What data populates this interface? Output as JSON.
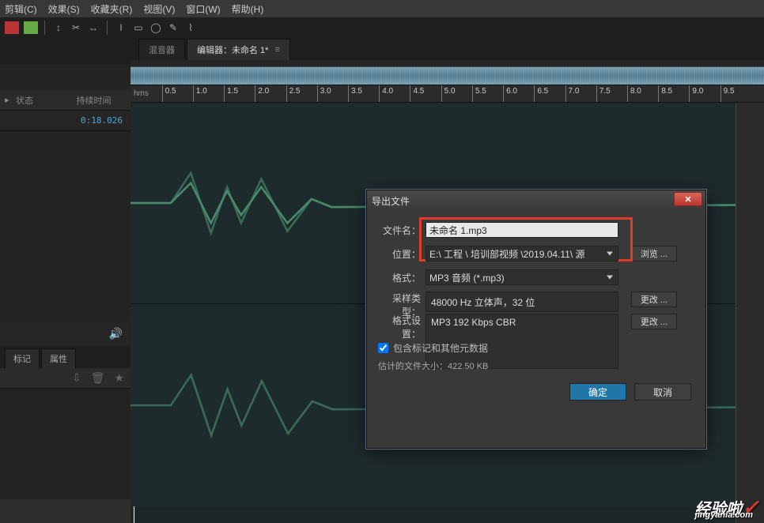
{
  "menu": {
    "items": [
      "剪辑(C)",
      "效果(S)",
      "收藏夹(R)",
      "视图(V)",
      "窗口(W)",
      "帮助(H)"
    ]
  },
  "side": {
    "col_state": "状态",
    "col_duration": "持续时间",
    "duration_value": "0:18.026",
    "tab_marker": "标记",
    "tab_props": "属性"
  },
  "tabs": {
    "mixer": "混音器",
    "editor": "编辑器：未命名 1*"
  },
  "ruler": {
    "unit": "hms",
    "ticks": [
      "0.5",
      "1.0",
      "1.5",
      "2.0",
      "2.5",
      "3.0",
      "3.5",
      "4.0",
      "4.5",
      "5.0",
      "5.5",
      "6.0",
      "6.5",
      "7.0",
      "7.5",
      "8.0",
      "8.5",
      "9.0",
      "9.5"
    ]
  },
  "dialog": {
    "title": "导出文件",
    "labels": {
      "filename": "文件名：",
      "location": "位置：",
      "format": "格式：",
      "sample": "采样类型：",
      "fmt_setting": "格式设置："
    },
    "values": {
      "filename": "未命名 1.mp3",
      "location": "E:\\ 工程 \\ 培训部视频 \\2019.04.11\\ 源",
      "format": "MP3 音频 (*.mp3)",
      "sample": "48000 Hz 立体声，32 位",
      "fmt_setting": "MP3 192 Kbps CBR"
    },
    "buttons": {
      "browse": "浏览 ...",
      "change": "更改 ...",
      "ok": "确定",
      "cancel": "取消"
    },
    "checkbox": "包含标记和其他元数据",
    "filesize": "估计的文件大小：422.50 KB"
  },
  "watermark": {
    "text": "经验啦",
    "sub": "jingyanla.com"
  }
}
